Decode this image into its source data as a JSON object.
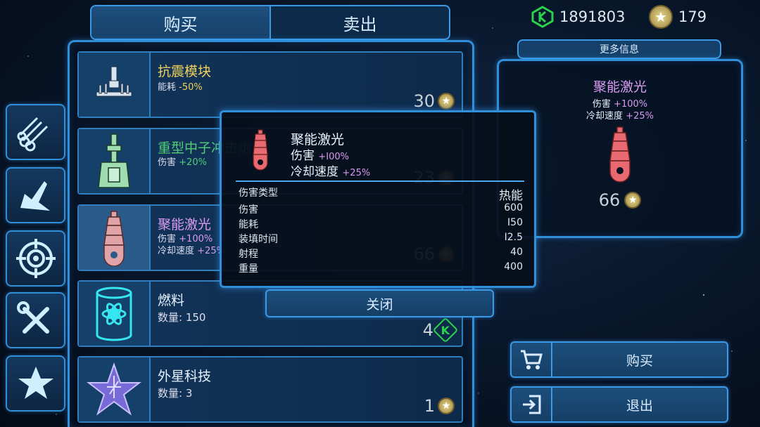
{
  "tabs": {
    "buy": "购买",
    "sell": "卖出"
  },
  "currency": {
    "credits": "1891803",
    "stars": "179"
  },
  "sidebar": [
    {
      "name": "sidebar-pipes",
      "icon": "pipes-icon"
    },
    {
      "name": "sidebar-engine",
      "icon": "engine-icon"
    },
    {
      "name": "sidebar-target",
      "icon": "crosshair-icon"
    },
    {
      "name": "sidebar-tools",
      "icon": "tools-icon"
    },
    {
      "name": "sidebar-star",
      "icon": "star-icon"
    }
  ],
  "items": [
    {
      "name": "抗震模块",
      "stat1": "能耗",
      "stat1_val": "-50%",
      "price": "30",
      "currency": "star-coin"
    },
    {
      "name": "重型中子冲击炮",
      "stat1": "伤害",
      "stat1_val": "+20%",
      "price": "23",
      "currency": "star-coin"
    },
    {
      "name": "聚能激光",
      "stat1": "伤害",
      "stat1_val": "+100%",
      "stat2": "冷却速度",
      "stat2_val": "+25%",
      "price": "66",
      "currency": "star-coin"
    },
    {
      "name": "燃料",
      "stat1": "数量:",
      "stat1_val": "150",
      "price": "4",
      "currency": "gem"
    },
    {
      "name": "外星科技",
      "stat1": "数量:",
      "stat1_val": "3",
      "price": "1",
      "currency": "star-coin"
    }
  ],
  "info": {
    "header": "更多信息",
    "name": "聚能激光",
    "stat1": "伤害",
    "stat1_val": "+100%",
    "stat2": "冷却速度",
    "stat2_val": "+25%",
    "price": "66"
  },
  "popup": {
    "name": "聚能激光",
    "stat1": "伤害",
    "stat1_val": "+I00%",
    "stat2": "冷却速度",
    "stat2_val": "+25%",
    "rows": [
      {
        "label": "伤害类型",
        "value": "热能"
      },
      {
        "label": "伤害",
        "value": "600"
      },
      {
        "label": "能耗",
        "value": "I50"
      },
      {
        "label": "装填时间",
        "value": "I2.5"
      },
      {
        "label": "射程",
        "value": "40"
      },
      {
        "label": "重量",
        "value": "400"
      }
    ],
    "close_label": "关闭"
  },
  "actions": {
    "buy_label": "购买",
    "exit_label": "退出"
  },
  "colors": {
    "accent": "#2f8fd8",
    "yellow_name": "#f0d25a",
    "green_name": "#4fcf7a",
    "purple_name": "#d89af0",
    "gem_green": "#2bd24c"
  }
}
